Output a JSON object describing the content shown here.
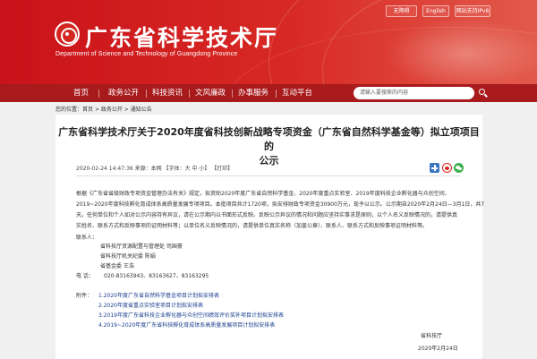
{
  "top_links": [
    "无障碍",
    "English",
    "网站支持IPv6"
  ],
  "site": {
    "title": "广东省科学技术厅",
    "subtitle": "Department of Science and Technology of Guangdong Province"
  },
  "nav": {
    "items": [
      "首页",
      "政务公开",
      "科技资讯",
      "文风廉政",
      "办事服务",
      "互动平台"
    ]
  },
  "search": {
    "placeholder": "请输入要搜索的内容"
  },
  "breadcrumb": {
    "prefix": "您的位置：",
    "items": [
      "首页",
      "政务公开",
      "通知公告"
    ],
    "separator": " > "
  },
  "article": {
    "title_line1": "广东省科学技术厅关于2020年度省科技创新战略专项资金（广东省自然科学基金等）拟立项项目的",
    "title_line2": "公示",
    "meta": "2020-02-24 14:47:36   来源：本网   【字体：大  中  小】   【打印】",
    "paragraphs": [
      "根据《广东省省级财政专项资金管理办法有关》规定，拟资助2020年度广东省自然科学基金、2020年度重点实验室、2019年度科技企业孵化器与众创空间、",
      "2019~2020年度科技孵化育成体系高质量发展专项项目。本批项目共计1720项，拟安排财政专项资金30900万元，现予以公示。公示期自2020年2月24日—3月1日，共7",
      "天。任何单位和个人如对公示内容持有异议，请在公示期内以书面形式反映。反映公示异议的情况和问题应坚持实事求是原则，以个人名义反映情况的，请提供真",
      "实姓名、联系方式和反映事项的证明材料等；以单位名义反映情况的，请提供单位真实名称（加盖公章）、联系人、联系方式和反映事项证明材料等。"
    ],
    "contacts_label": "联系人：",
    "contacts": [
      "省科技厅资源配置与管理处  司国豪",
      "省科技厅机关纪委  陈娟",
      "省基金委  王浩"
    ],
    "phone_label": "电     话：",
    "phones": "020-83163943、83163627、83163295",
    "attachments_label": "附件：",
    "attachments": [
      "1.2020年度广东省自然科学基金项目计划拟安排表",
      "2.2020年度省重点实验室项目计划拟安排表",
      "3.2019年度广东省科技企业孵化器与众创空间绩效评价奖补项目计划拟安排表",
      "4.2019~2020年度广东省科技孵化育成体系高质量发展项目计划拟安排表"
    ],
    "signature": "省科技厅",
    "date": "2020年2月24日"
  },
  "colors": {
    "brand_red": "#c9121a",
    "nav_red": "#a81a1c",
    "share_plus": "#3a76c4",
    "share_weibo": "#e0231c",
    "share_wechat": "#3fb34f"
  }
}
